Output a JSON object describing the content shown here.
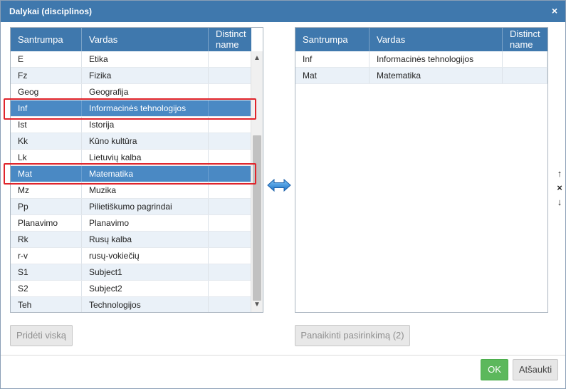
{
  "dialog": {
    "title": "Dalykai (disciplinos)",
    "close_icon": "×"
  },
  "left_table": {
    "columns": [
      "Santrumpa",
      "Vardas",
      "Distinct name"
    ],
    "rows": [
      {
        "abbr": "E",
        "name": "Etika",
        "distinct": ""
      },
      {
        "abbr": "Fz",
        "name": "Fizika",
        "distinct": ""
      },
      {
        "abbr": "Geog",
        "name": "Geografija",
        "distinct": ""
      },
      {
        "abbr": "Inf",
        "name": "Informacinės tehnologijos",
        "distinct": "",
        "selected": true
      },
      {
        "abbr": "Ist",
        "name": "Istorija",
        "distinct": ""
      },
      {
        "abbr": "Kk",
        "name": "Kūno kultūra",
        "distinct": ""
      },
      {
        "abbr": "Lk",
        "name": "Lietuvių kalba",
        "distinct": ""
      },
      {
        "abbr": "Mat",
        "name": "Matematika",
        "distinct": "",
        "selected": true
      },
      {
        "abbr": "Mz",
        "name": "Muzika",
        "distinct": ""
      },
      {
        "abbr": "Pp",
        "name": "Pilietiškumo pagrindai",
        "distinct": ""
      },
      {
        "abbr": "Planavimo",
        "name": "Planavimo",
        "distinct": ""
      },
      {
        "abbr": "Rk",
        "name": "Rusų kalba",
        "distinct": ""
      },
      {
        "abbr": "r-v",
        "name": "rusų-vokiečių",
        "distinct": ""
      },
      {
        "abbr": "S1",
        "name": "Subject1",
        "distinct": ""
      },
      {
        "abbr": "S2",
        "name": "Subject2",
        "distinct": ""
      },
      {
        "abbr": "Teh",
        "name": "Technologijos",
        "distinct": ""
      }
    ]
  },
  "right_table": {
    "columns": [
      "Santrumpa",
      "Vardas",
      "Distinct name"
    ],
    "rows": [
      {
        "abbr": "Inf",
        "name": "Informacinės tehnologijos",
        "distinct": ""
      },
      {
        "abbr": "Mat",
        "name": "Matematika",
        "distinct": ""
      }
    ]
  },
  "buttons": {
    "add_all": "Pridėti viską",
    "remove_selection": "Panaikinti pasirinkimą (2)",
    "ok": "OK",
    "cancel": "Atšaukti"
  },
  "side_controls": {
    "up": "↑",
    "remove": "×",
    "down": "↓"
  },
  "colors": {
    "header_blue": "#3f78ad",
    "selected_row": "#4a89c4",
    "highlight_red": "#e0242b",
    "ok_green": "#5cb85c"
  }
}
